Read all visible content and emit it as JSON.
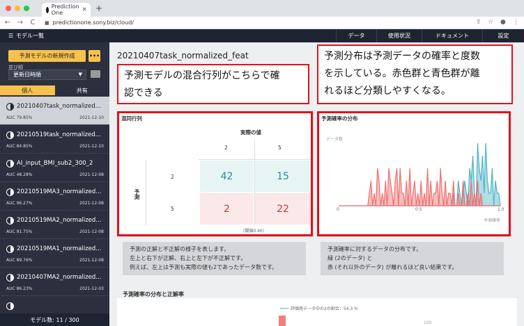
{
  "browser": {
    "tab_title": "Prediction One",
    "new_tab": "+",
    "tab_close": "×",
    "url": "predictionone.sony.biz/cloud/",
    "nav": {
      "back": "←",
      "forward": "→",
      "reload": "C"
    }
  },
  "appbar": {
    "model_list": "モデル一覧",
    "menu_icon": "☰",
    "nav": [
      "データ",
      "使用状況",
      "ドキュメント",
      "設定"
    ]
  },
  "sidebar": {
    "new_model": "予測モデルの新規作成",
    "more": "•••",
    "sort_label": "並び順",
    "sort_value": "更新日時順",
    "tabs": [
      "個人",
      "共有"
    ],
    "models": [
      {
        "name": "20210407task_normalized...",
        "auc": "AUC 79.85%",
        "date": "2021-12-10",
        "selected": true
      },
      {
        "name": "20210519task_normalized...",
        "auc": "AUC 84.85%",
        "date": "2021-12-10",
        "selected": false
      },
      {
        "name": "AI_input_BMI_sub2_300_2",
        "auc": "AUC 48.28%",
        "date": "2021-12-08",
        "selected": false
      },
      {
        "name": "20210519MA3_normalized...",
        "auc": "AUC 96.27%",
        "date": "2021-12-08",
        "selected": false
      },
      {
        "name": "20210519MA2_normalized...",
        "auc": "AUC 91.75%",
        "date": "2021-12-08",
        "selected": false
      },
      {
        "name": "20210519MA1_normalized...",
        "auc": "AUC 89.76%",
        "date": "2021-12-08",
        "selected": false
      },
      {
        "name": "20210407MA2_normalized...",
        "auc": "AUC 86.23%",
        "date": "2021-12-03",
        "selected": false
      },
      {
        "name": "",
        "auc": "",
        "date": "",
        "selected": false
      }
    ],
    "model_count": "モデル数: 11 / 300"
  },
  "main": {
    "title": "20210407task_normalized_feat",
    "confusion": {
      "title": "混同行列",
      "actual_label": "実際の値",
      "pred_label": "予測",
      "col_labels": [
        "2",
        "5"
      ],
      "row_labels": [
        "2",
        "5"
      ],
      "cells": [
        "42",
        "15",
        "2",
        "22"
      ],
      "threshold": "(閾値0.46)"
    },
    "distribution": {
      "title": "予測確率の分布",
      "ylabel": "データ数",
      "xlabel": "予測確率",
      "xticks": [
        "0",
        "0.5",
        "1.0"
      ]
    },
    "desc_left": [
      "予測の正解と不正解の様子を表します。",
      "左上と右下が正解、右上と左下が不正解です。",
      "例えば、左上は予測も実際の値も2であったデータ数です。"
    ],
    "desc_right": [
      "予測確率に対するデータの分布です。",
      "緑 (2のデータ) と",
      "赤 (それ以外のデータ) が離れるほど良い結果です。"
    ],
    "bottom_title": "予測確率の分布と正解率",
    "bottom_legend": "評価用データ中の2の割合：54.3 %",
    "bottom_tick": "100"
  },
  "callouts": {
    "left": [
      "予測モデルの混合行列がこちらで確",
      "認できる"
    ],
    "right": [
      "予測分布は予測データの確率と度数",
      "を示している。赤色群と青色群が離",
      "れるほど分類しやすくなる。"
    ]
  },
  "chart_data": {
    "type": "area",
    "title": "予測確率の分布",
    "xlabel": "予測確率",
    "ylabel": "データ数",
    "xlim": [
      0,
      1
    ],
    "series": [
      {
        "values": [
          0,
          0,
          0,
          0,
          0,
          0,
          0,
          0,
          0,
          0,
          0,
          0,
          0,
          0,
          0,
          0,
          0,
          0,
          0,
          0,
          0,
          0,
          0,
          0,
          0,
          0,
          0,
          0,
          0,
          0,
          0,
          0,
          0,
          0,
          0,
          0,
          0,
          0,
          0,
          0,
          0,
          0,
          0,
          0,
          0,
          0,
          0,
          0,
          0,
          0,
          0,
          0,
          0,
          0,
          0,
          0,
          0,
          0,
          0,
          0,
          0,
          0,
          0,
          0,
          0,
          0,
          0,
          0,
          0,
          0,
          0,
          1,
          0,
          0,
          2,
          1,
          0,
          1,
          2,
          1,
          0,
          3,
          2,
          4,
          1,
          0,
          5,
          3,
          2,
          4,
          1,
          5,
          2,
          1,
          1,
          3,
          0,
          2,
          1,
          1,
          0
        ]
      },
      {
        "values": [
          0,
          0,
          0,
          0,
          0,
          0,
          0,
          0,
          0,
          0,
          0,
          0,
          0,
          0,
          0,
          0,
          0,
          0,
          0,
          1,
          2,
          0,
          1,
          0,
          3,
          2,
          0,
          1,
          0,
          2,
          0,
          3,
          2,
          1,
          0,
          2,
          3,
          0,
          3,
          1,
          1,
          0,
          2,
          0,
          3,
          0,
          1,
          2,
          0,
          1,
          0,
          2,
          0,
          1,
          0,
          3,
          0,
          2,
          0,
          1,
          1,
          2,
          0,
          3,
          1,
          0,
          2,
          0,
          1,
          1,
          0,
          2,
          0,
          0,
          1,
          0,
          0,
          2,
          0,
          0,
          1,
          0,
          2,
          0,
          1,
          0,
          2,
          0,
          1,
          0,
          0,
          0,
          0,
          0,
          0,
          0,
          0,
          0,
          0,
          0,
          0
        ]
      }
    ],
    "colors": {
      "positive": "#4fb3c7",
      "negative": "#f06f6f",
      "overlap": "#b9b9b9"
    }
  }
}
